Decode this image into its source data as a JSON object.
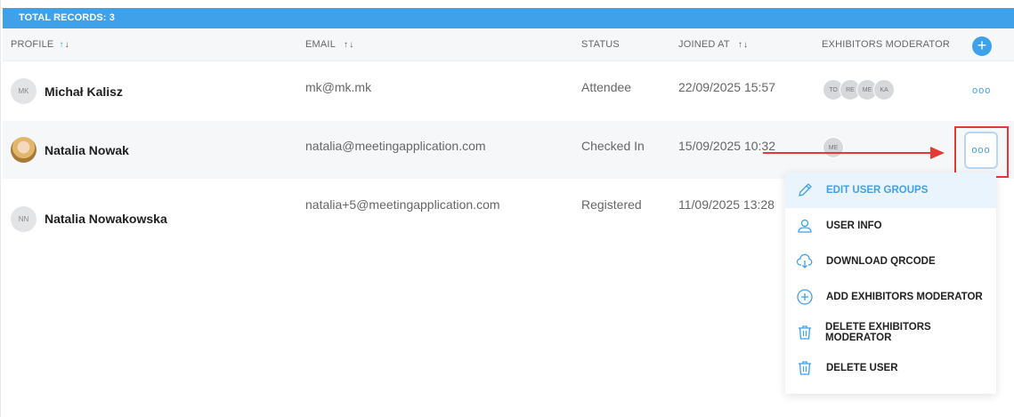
{
  "records": {
    "label": "TOTAL RECORDS: 3"
  },
  "columns": {
    "profile": "PROFILE",
    "email": "EMAIL",
    "status": "STATUS",
    "joined": "JOINED AT",
    "moderator": "EXHIBITORS MODERATOR"
  },
  "add_icon": "+",
  "rows": [
    {
      "initials": "MK",
      "name": "Michał Kalisz",
      "email": "mk@mk.mk",
      "status": "Attendee",
      "joined": "22/09/2025 15:57",
      "moderators": [
        "TO",
        "RE",
        "ME",
        "KA"
      ]
    },
    {
      "initials": "",
      "name": "Natalia Nowak",
      "email": "natalia@meetingapplication.com",
      "status": "Checked In",
      "joined": "15/09/2025 10:32",
      "moderators": [
        "ME"
      ]
    },
    {
      "initials": "NN",
      "name": "Natalia Nowakowska",
      "email": "natalia+5@meetingapplication.com",
      "status": "Registered",
      "joined": "11/09/2025 13:28",
      "moderators": []
    }
  ],
  "more_icon": "ooo",
  "menu": {
    "items": [
      {
        "label": "EDIT USER GROUPS",
        "icon": "pencil-icon"
      },
      {
        "label": "USER INFO",
        "icon": "user-icon"
      },
      {
        "label": "DOWNLOAD QRCODE",
        "icon": "cloud-download-icon"
      },
      {
        "label": "ADD EXHIBITORS MODERATOR",
        "icon": "plus-circle-icon"
      },
      {
        "label": "DELETE EXHIBITORS MODERATOR",
        "icon": "trash-icon"
      },
      {
        "label": "DELETE USER",
        "icon": "trash-icon"
      }
    ]
  },
  "colors": {
    "accent": "#3fa1e9",
    "annotation": "#e53935"
  }
}
